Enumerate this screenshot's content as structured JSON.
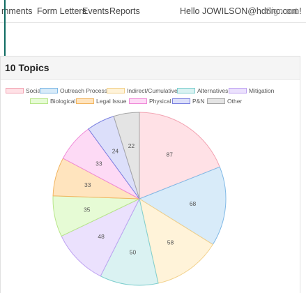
{
  "nav": {
    "links": [
      "mments",
      "Form Letters",
      "Events",
      "Reports"
    ],
    "greeting": "Hello JOWILSON@hdrinc.com!",
    "signout": "Sign out"
  },
  "card": {
    "title": "10 Topics"
  },
  "chart_data": {
    "type": "pie",
    "title": "10 Topics",
    "categories": [
      "Social",
      "Outreach Process",
      "Indirect/Cumulative",
      "Alternatives",
      "Mitigation",
      "Biological",
      "Legal Issue",
      "Physical",
      "P&N",
      "Other"
    ],
    "values": [
      87,
      68,
      58,
      50,
      48,
      35,
      33,
      33,
      24,
      22
    ],
    "colors": {
      "fill": [
        "#ffe1e6",
        "#d8ebf9",
        "#fff3d9",
        "#daf2f2",
        "#ebe1fd",
        "#e6fbd5",
        "#ffe4be",
        "#fddaf5",
        "#dcdffa",
        "#e4e4e4"
      ],
      "stroke": [
        "#f2a3b2",
        "#80b9e6",
        "#f2d08a",
        "#80cfcf",
        "#bfa3f2",
        "#b8e68a",
        "#f2b560",
        "#f08ad8",
        "#7a80e0",
        "#a6a6a6"
      ]
    },
    "legend_position": "top"
  }
}
